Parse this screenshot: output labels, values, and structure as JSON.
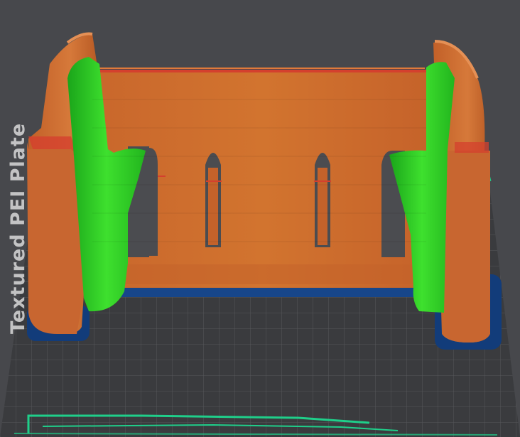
{
  "bed": {
    "label": "Textured PEI Plate"
  },
  "colors": {
    "background": "#47484c",
    "bed_surface": "#2e2f32",
    "grid": "#4a4b4f",
    "bed_edge": "#1fcf8a",
    "wall": "#cc6a2f",
    "wall_shade": "#b55a24",
    "support": "#2ed51f",
    "brim": "#123c7a",
    "top_edge": "#d4402e"
  },
  "model": {
    "parts": [
      "left-post",
      "right-post",
      "back-wall",
      "window-slot-left-outer",
      "window-slot-left-inner",
      "window-slot-right-inner",
      "window-slot-right-outer",
      "support-left",
      "support-right",
      "brim-left",
      "brim-right",
      "brim-center"
    ]
  }
}
